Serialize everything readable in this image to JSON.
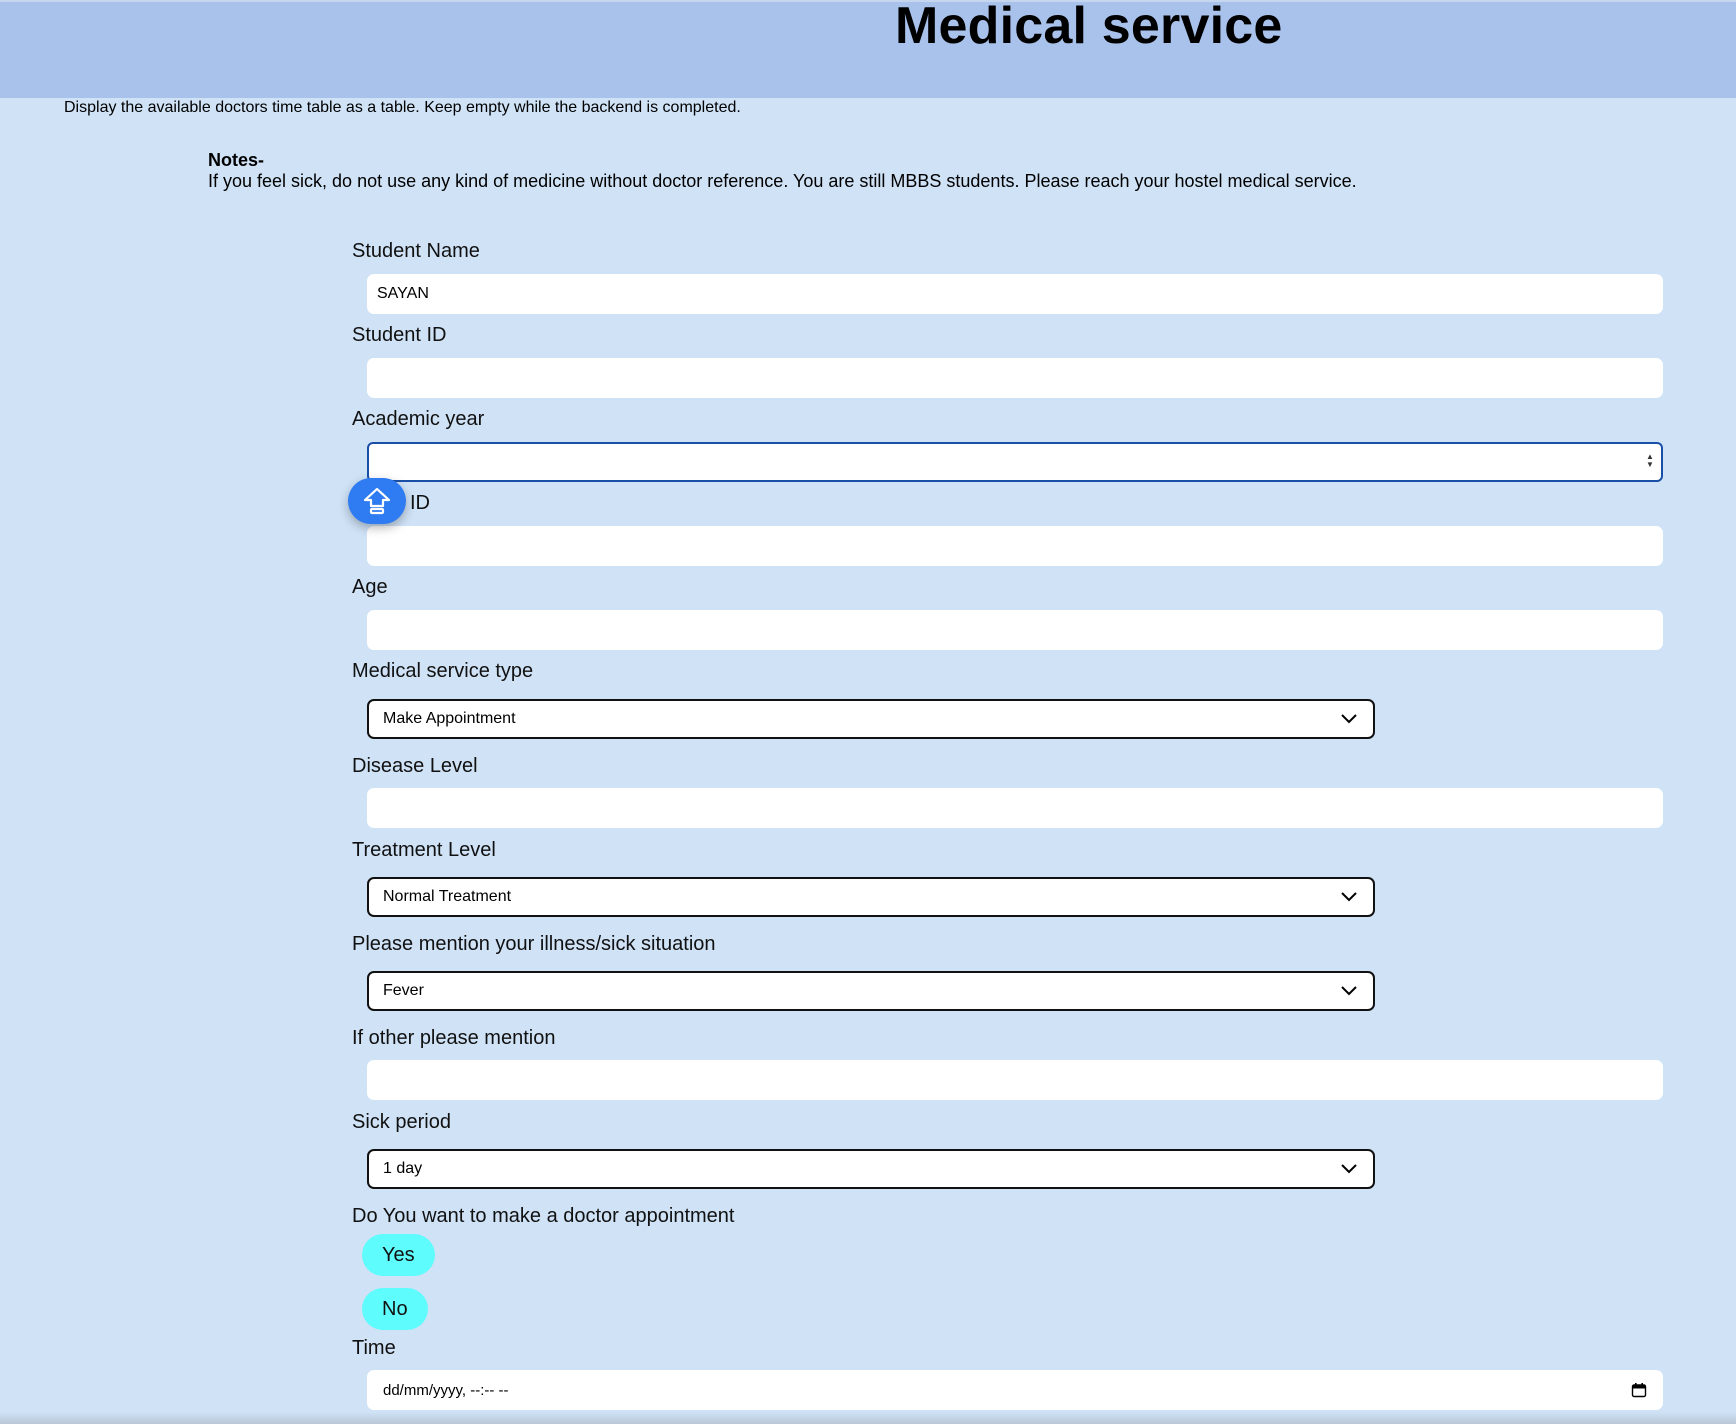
{
  "header": {
    "title": "Medical service",
    "background": "#a9c2ec"
  },
  "instruction": "Display the available doctors time table as a table. Keep empty while the backend is completed.",
  "notes": {
    "title": "Notes-",
    "text": "If you feel sick, do not use any kind of medicine without doctor reference. You are still MBBS students. Please reach your hostel medical service."
  },
  "form": {
    "student_name": {
      "label": "Student Name",
      "value": "SAYAN"
    },
    "student_id": {
      "label": "Student ID",
      "value": ""
    },
    "academic_year": {
      "label": "Academic year",
      "value": ""
    },
    "hidden_id": {
      "label": "ID",
      "value": ""
    },
    "age": {
      "label": "Age",
      "value": ""
    },
    "service_type": {
      "label": "Medical service type",
      "selected": "Make Appointment"
    },
    "disease_level": {
      "label": "Disease Level",
      "value": ""
    },
    "treatment_level": {
      "label": "Treatment Level",
      "selected": "Normal Treatment"
    },
    "illness": {
      "label": "Please mention your illness/sick situation",
      "selected": "Fever"
    },
    "other": {
      "label": "If other please mention",
      "value": ""
    },
    "sick_period": {
      "label": "Sick period",
      "selected": "1 day"
    },
    "appointment": {
      "label": "Do You want to make a doctor appointment",
      "yes": "Yes",
      "no": "No"
    },
    "time": {
      "label": "Time",
      "placeholder": "dd/mm/yyyy, --:-- --"
    }
  },
  "icons": {
    "fab": "home-up-arrow-icon",
    "select": "chevron-down-icon",
    "calendar": "calendar-icon"
  },
  "colors": {
    "accent_pill": "#5ffcfd",
    "fab": "#2f7bf2",
    "page_bg": "#cfe2f6"
  }
}
